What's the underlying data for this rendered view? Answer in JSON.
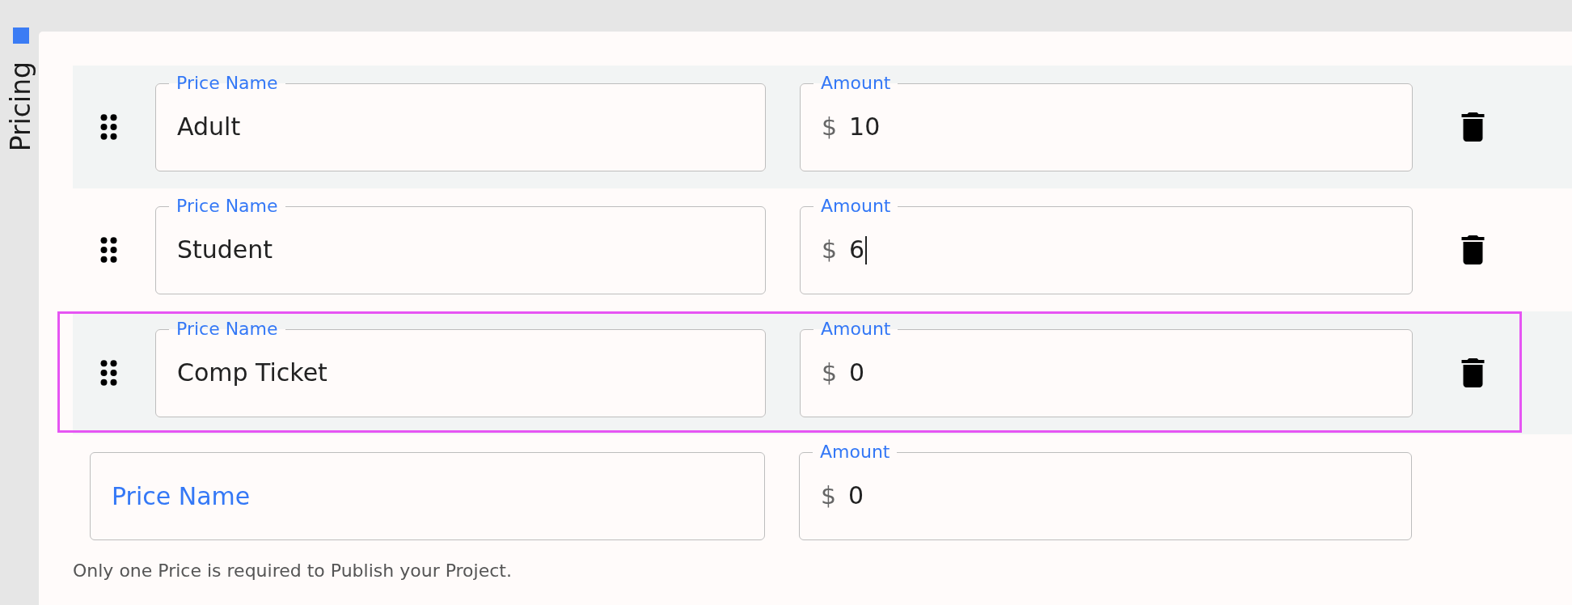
{
  "sidebar": {
    "label": "Pricing"
  },
  "prices": [
    {
      "name_field": {
        "label": "Price Name",
        "value": "Adult"
      },
      "amount_field": {
        "label": "Amount",
        "currency": "$",
        "value": "10",
        "focused": false
      },
      "shaded": true,
      "outlined": false
    },
    {
      "name_field": {
        "label": "Price Name",
        "value": "Student"
      },
      "amount_field": {
        "label": "Amount",
        "currency": "$",
        "value": "6",
        "focused": true
      },
      "shaded": false,
      "outlined": false
    },
    {
      "name_field": {
        "label": "Price Name",
        "value": "Comp Ticket"
      },
      "amount_field": {
        "label": "Amount",
        "currency": "$",
        "value": "0",
        "focused": false
      },
      "shaded": true,
      "outlined": true
    }
  ],
  "new_price": {
    "name_field": {
      "placeholder": "Price Name"
    },
    "amount_field": {
      "label": "Amount",
      "currency": "$",
      "value": "0"
    }
  },
  "note": "Only one Price is required to Publish your Project."
}
